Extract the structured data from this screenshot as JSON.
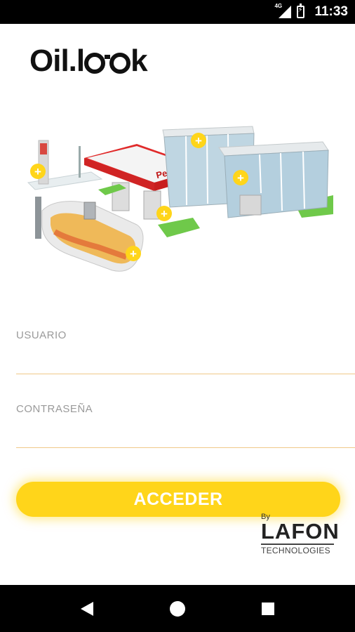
{
  "status_bar": {
    "network": "4G",
    "time": "11:33"
  },
  "app": {
    "logo_prefix": "Oil.l",
    "logo_suffix": "k"
  },
  "hero": {
    "sign_text": "Petrol"
  },
  "form": {
    "username_label": "USUARIO",
    "username_value": "",
    "password_label": "CONTRASEÑA",
    "password_value": "",
    "submit_label": "ACCEDER"
  },
  "footer": {
    "by": "By",
    "brand": "LAFON",
    "tagline": "TECHNOLOGIES"
  },
  "colors": {
    "accent": "#ffd51a",
    "underline": "#f0c888",
    "label": "#9a9a9a"
  }
}
